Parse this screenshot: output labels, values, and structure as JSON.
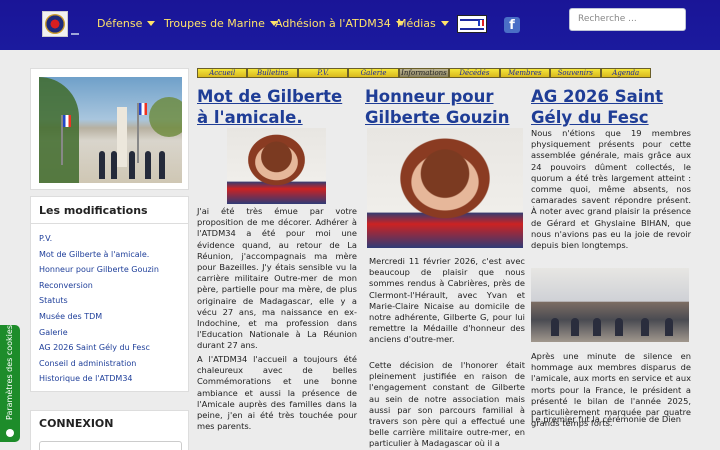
{
  "nav": {
    "items": [
      "Défense",
      "Troupes de Marine",
      "Adhésion à l'ATDM34",
      "Médias"
    ],
    "facebook": "f",
    "search_placeholder": "Recherche ..."
  },
  "sidebar": {
    "mods_title": "Les modifications",
    "mods": [
      "P.V.",
      "Mot de Gilberte à l'amicale.",
      "Honneur pour Gilberte Gouzin",
      "Reconversion",
      "Statuts",
      "Musée des TDM",
      "Galerie",
      "AG 2026 Saint Gély du Fesc",
      "Conseil d administration",
      "Historique de l'ATDM34"
    ],
    "connexion_title": "CONNEXION"
  },
  "cookie_label": "Paramètres des cookies",
  "strip": [
    "Accueil",
    "Bulletins",
    "P.V.",
    "Galerie",
    "Informations",
    "Décédés",
    "Membres",
    "Souvenirs",
    "Agenda"
  ],
  "articles": {
    "a1": {
      "title": "Mot de Gilberte à l'amicale.",
      "p1": "J'ai été très émue par votre proposition de me décorer. Adhérer à l'ATDM34 a été pour moi une évidence quand, au retour de La Réunion, j'accompagnais ma mère pour Bazeilles. J'y étais sensible vu la carrière militaire Outre-mer de mon père, partielle pour ma mère, de plus originaire de Madagascar, elle y a vécu 27 ans, ma naissance en ex-Indochine, et ma profession dans l'Education Nationale à La Réunion durant 27 ans.",
      "p2": "A l'ATDM34 l'accueil a toujours été chaleureux avec de belles Commémorations et une bonne ambiance et aussi la présence de l'Amicale auprès des familles dans la peine, j'en ai été très touchée pour mes parents."
    },
    "a2": {
      "title": "Honneur pour Gilberte Gouzin",
      "p1": "Mercredi 11 février 2026, c'est avec beaucoup de plaisir que nous sommes rendus à Cabrières, près de Clermont-l'Hérault, avec Yvan et Marie-Claire Nicaise au domicile de notre adhérente, Gilberte G, pour lui remettre la Médaille d'honneur des anciens d'outre-mer.",
      "p2": "Cette décision de l'honorer était pleinement justifiée en raison de l'engagement constant de Gilberte au sein de notre association mais aussi par son parcours familial à travers son père qui a effectué une belle carrière militaire outre-mer, en particulier à Madagascar où il a"
    },
    "a3": {
      "title": "AG 2026 Saint Gély du Fesc",
      "p1": "Nous n'étions que 19 membres physiquement présents pour cette assemblée générale, mais grâce aux 24 pouvoirs dûment collectés, le quorum a été très largement atteint : comme quoi, même absents, nos camarades savent répondre présent. À noter avec grand plaisir la présence de Gérard et Ghyslaine BIHAN, que nous n'avions pas eu la joie de revoir depuis bien longtemps.",
      "p2": "Après une minute de silence en hommage aux membres disparus de l'amicale, aux morts en service et aux morts pour la France, le président a présenté le bilan de l'année 2025, particulièrement marquée par quatre grands temps forts.",
      "p3": "Le premier fut la cérémonie de Dien"
    }
  }
}
